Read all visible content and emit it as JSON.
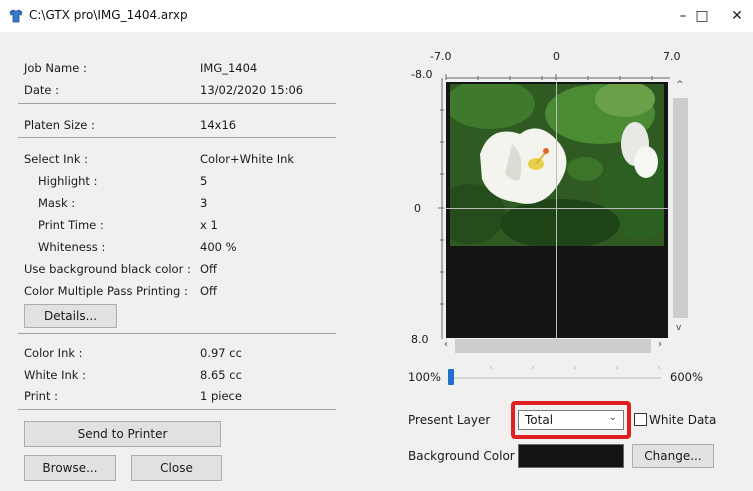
{
  "window": {
    "title": "C:\\GTX pro\\IMG_1404.arxp",
    "minimize": "–",
    "maximize": "□",
    "close": "✕"
  },
  "info": {
    "job_name_label": "Job Name :",
    "job_name": "IMG_1404",
    "date_label": "Date :",
    "date": "13/02/2020 15:06",
    "platen_label": "Platen Size :",
    "platen": "14x16",
    "ink_label": "Select Ink :",
    "ink": "Color+White Ink",
    "highlight_label": "Highlight :",
    "highlight": "5",
    "mask_label": "Mask :",
    "mask": "3",
    "print_time_label": "Print Time :",
    "print_time": "x 1",
    "whiteness_label": "Whiteness :",
    "whiteness": "400 %",
    "bg_black_label": "Use background black color :",
    "bg_black": "Off",
    "multi_pass_label": "Color Multiple Pass Printing :",
    "multi_pass": "Off",
    "color_ink_label": "Color Ink :",
    "color_ink": "0.97 cc",
    "white_ink_label": "White Ink :",
    "white_ink": "8.65 cc",
    "print_label": "Print :",
    "print": "1 piece"
  },
  "buttons": {
    "details": "Details...",
    "send": "Send to Printer",
    "browse": "Browse...",
    "close": "Close",
    "change": "Change..."
  },
  "preview": {
    "x_ticks": [
      "-7.0",
      "0",
      "7.0"
    ],
    "y_ticks": [
      "-8.0",
      "0",
      "8.0"
    ],
    "zoom_min": "100%",
    "zoom_max": "600%",
    "zoom_level": 0
  },
  "layer": {
    "label": "Present Layer",
    "selected": "Total",
    "white_data_label": "White Data",
    "white_data_checked": false
  },
  "background": {
    "label": "Background Color",
    "color": "#141414"
  },
  "colors": {
    "highlight_border": "#e02020",
    "slider_thumb": "#1f6fd1"
  }
}
